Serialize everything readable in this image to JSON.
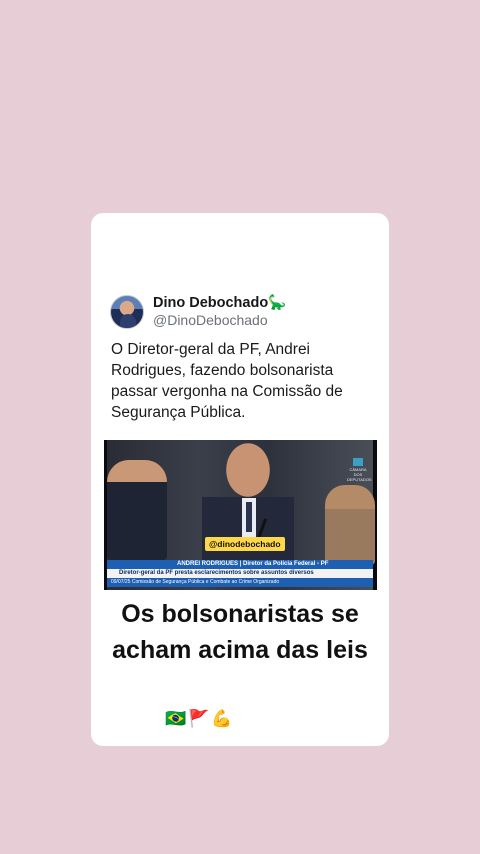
{
  "tweet": {
    "display_name": "Dino Debochado🦕",
    "handle": "@DinoDebochado",
    "text": "O Diretor-geral da PF, Andrei Rodrigues, fazendo bolsonarista passar vergonha na Comissão de Segurança Pública."
  },
  "video": {
    "watermark": "@dinodebochado",
    "lower_third_name": "ANDREI RODRIGUES | Diretor da Polícia Federal - PF",
    "lower_third_subtitle": "Diretor-geral da PF presta esclarecimentos sobre assuntos diversos",
    "lower_third_footer": "09/07/25   Comissão de Segurança Pública e Combate ao Crime Organizado",
    "channel_logo_text": "CÂMARA DOS DEPUTADOS"
  },
  "caption": "Os bolsonaristas se acham acima das leis",
  "emojis": "🇧🇷🚩💪"
}
